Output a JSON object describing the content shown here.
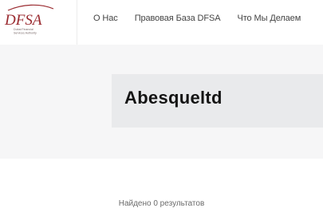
{
  "header": {
    "logo": {
      "mark": "DFSA",
      "tagline_lines": [
        "Dubai Financial",
        "Services Authority"
      ]
    },
    "nav": [
      {
        "label": "О Нас"
      },
      {
        "label": "Правовая База DFSA"
      },
      {
        "label": "Что Мы Делаем"
      }
    ]
  },
  "banner": {
    "title": "Abesqueltd"
  },
  "results": {
    "text": "Найдено 0 результатов"
  },
  "colors": {
    "logo_red": "#9a2a2f",
    "banner_bg": "#f6f6f7",
    "card_bg": "#e9eaec"
  }
}
